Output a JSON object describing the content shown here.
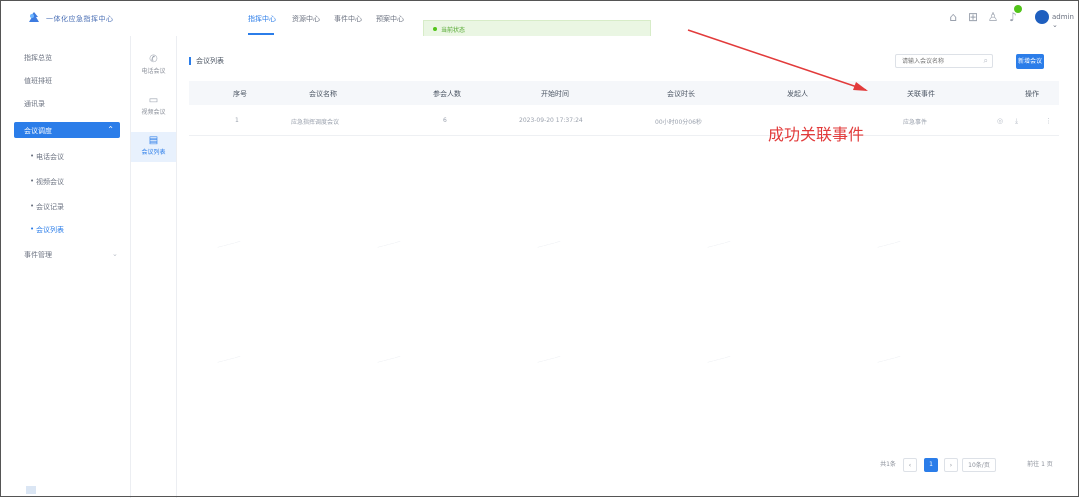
{
  "header": {
    "app_title": "一体化应急指挥中心",
    "nav": [
      "指挥中心",
      "资源中心",
      "事件中心",
      "预案中心"
    ],
    "notice": "当前状态",
    "user": "admin"
  },
  "sidebar": {
    "items": [
      "指挥总览",
      "值班排班",
      "通讯录",
      "会议调度",
      "事件管理"
    ],
    "sub_items": [
      "电话会议",
      "视频会议",
      "会议记录",
      "会议列表"
    ]
  },
  "icon_column": {
    "items": [
      "电话会议",
      "视频会议",
      "会议列表"
    ]
  },
  "main": {
    "page_title": "会议列表",
    "search_placeholder": "请输入会议名称",
    "new_button": "新增会议",
    "columns": [
      "序号",
      "会议名称",
      "参会人数",
      "开始时间",
      "会议时长",
      "发起人",
      "关联事件",
      "操作"
    ],
    "rows": [
      {
        "index": "1",
        "name": "应急指挥调度会议",
        "count": "6",
        "start": "2023-09-20 17:37:24",
        "duration": "00小时00分06秒",
        "initiator": "",
        "event": "应急事件"
      }
    ]
  },
  "annotation": {
    "text": "成功关联事件",
    "color": "#e23b3b"
  },
  "pagination": {
    "total": "共1条",
    "current_page": "1",
    "per_page": "10条/页",
    "goto": "前往 1 页"
  },
  "colors": {
    "accent": "#2b7de9",
    "success": "#52c41a"
  }
}
